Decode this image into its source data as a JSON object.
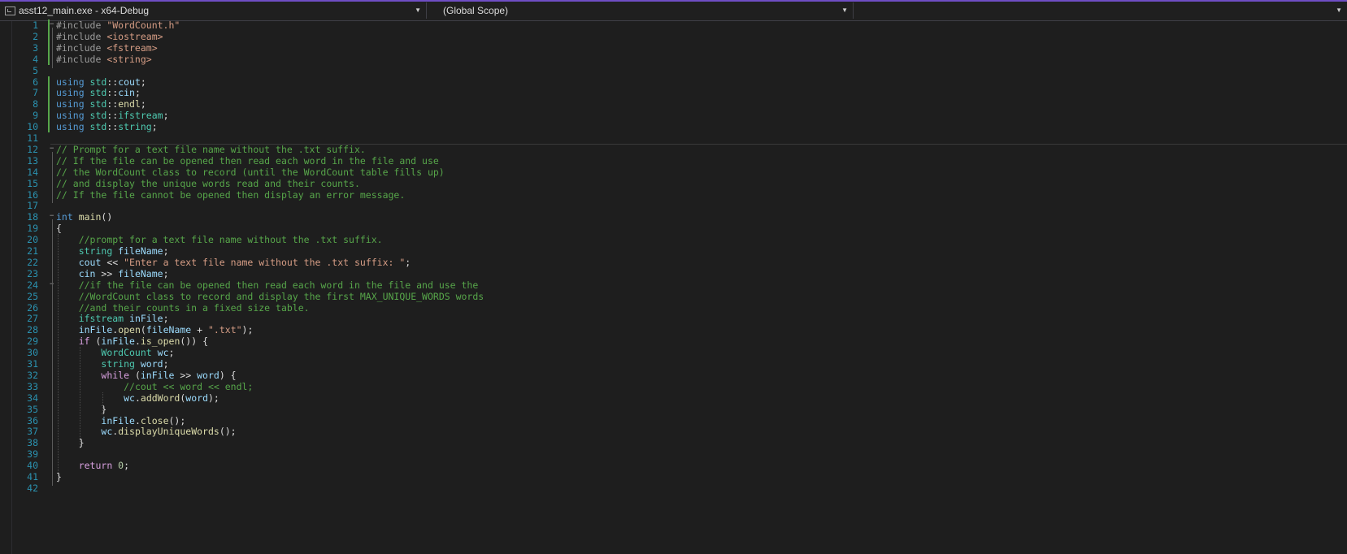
{
  "navbar": {
    "project": "asst12_main.exe - x64-Debug",
    "scope": "(Global Scope)",
    "member": ""
  },
  "editor": {
    "lines": [
      {
        "n": "1",
        "segs": [
          {
            "t": "#include ",
            "c": "pp"
          },
          {
            "t": "\"WordCount.h\"",
            "c": "str"
          }
        ]
      },
      {
        "n": "2",
        "segs": [
          {
            "t": "#include ",
            "c": "pp"
          },
          {
            "t": "<iostream>",
            "c": "str"
          }
        ]
      },
      {
        "n": "3",
        "segs": [
          {
            "t": "#include ",
            "c": "pp"
          },
          {
            "t": "<fstream>",
            "c": "str"
          }
        ]
      },
      {
        "n": "4",
        "segs": [
          {
            "t": "#include ",
            "c": "pp"
          },
          {
            "t": "<string>",
            "c": "str"
          }
        ]
      },
      {
        "n": "5",
        "segs": []
      },
      {
        "n": "6",
        "segs": [
          {
            "t": "using ",
            "c": "kw"
          },
          {
            "t": "std",
            "c": "ty"
          },
          {
            "t": "::",
            "c": ""
          },
          {
            "t": "cout",
            "c": "var"
          },
          {
            "t": ";",
            "c": ""
          }
        ]
      },
      {
        "n": "7",
        "segs": [
          {
            "t": "using ",
            "c": "kw"
          },
          {
            "t": "std",
            "c": "ty"
          },
          {
            "t": "::",
            "c": ""
          },
          {
            "t": "cin",
            "c": "var"
          },
          {
            "t": ";",
            "c": ""
          }
        ]
      },
      {
        "n": "8",
        "segs": [
          {
            "t": "using ",
            "c": "kw"
          },
          {
            "t": "std",
            "c": "ty"
          },
          {
            "t": "::",
            "c": ""
          },
          {
            "t": "endl",
            "c": "fn"
          },
          {
            "t": ";",
            "c": ""
          }
        ]
      },
      {
        "n": "9",
        "segs": [
          {
            "t": "using ",
            "c": "kw"
          },
          {
            "t": "std",
            "c": "ty"
          },
          {
            "t": "::",
            "c": ""
          },
          {
            "t": "ifstream",
            "c": "ty"
          },
          {
            "t": ";",
            "c": ""
          }
        ]
      },
      {
        "n": "10",
        "segs": [
          {
            "t": "using ",
            "c": "kw"
          },
          {
            "t": "std",
            "c": "ty"
          },
          {
            "t": "::",
            "c": ""
          },
          {
            "t": "string",
            "c": "ty"
          },
          {
            "t": ";",
            "c": ""
          }
        ]
      },
      {
        "n": "11",
        "segs": []
      },
      {
        "n": "12",
        "segs": [
          {
            "t": "// Prompt for a text file name without the .txt suffix.",
            "c": "cm"
          }
        ]
      },
      {
        "n": "13",
        "segs": [
          {
            "t": "// If the file can be opened then read each word in the file and use",
            "c": "cm"
          }
        ]
      },
      {
        "n": "14",
        "segs": [
          {
            "t": "// the WordCount class to record (until the WordCount table fills up)",
            "c": "cm"
          }
        ]
      },
      {
        "n": "15",
        "segs": [
          {
            "t": "// and display the unique words read and their counts.",
            "c": "cm"
          }
        ]
      },
      {
        "n": "16",
        "segs": [
          {
            "t": "// If the file cannot be opened then display an error message.",
            "c": "cm"
          }
        ]
      },
      {
        "n": "17",
        "segs": []
      },
      {
        "n": "18",
        "segs": [
          {
            "t": "int ",
            "c": "kw"
          },
          {
            "t": "main",
            "c": "fn"
          },
          {
            "t": "()",
            "c": ""
          }
        ]
      },
      {
        "n": "19",
        "segs": [
          {
            "t": "{",
            "c": ""
          }
        ]
      },
      {
        "n": "20",
        "segs": [
          {
            "t": "    ",
            "c": ""
          },
          {
            "t": "//prompt for a text file name without the .txt suffix.",
            "c": "cm"
          }
        ]
      },
      {
        "n": "21",
        "segs": [
          {
            "t": "    ",
            "c": ""
          },
          {
            "t": "string ",
            "c": "ty"
          },
          {
            "t": "fileName",
            "c": "var"
          },
          {
            "t": ";",
            "c": ""
          }
        ]
      },
      {
        "n": "22",
        "segs": [
          {
            "t": "    ",
            "c": ""
          },
          {
            "t": "cout ",
            "c": "var"
          },
          {
            "t": "<< ",
            "c": ""
          },
          {
            "t": "\"Enter a text file name without the .txt suffix: \"",
            "c": "str"
          },
          {
            "t": ";",
            "c": ""
          }
        ]
      },
      {
        "n": "23",
        "segs": [
          {
            "t": "    ",
            "c": ""
          },
          {
            "t": "cin ",
            "c": "var"
          },
          {
            "t": ">> ",
            "c": ""
          },
          {
            "t": "fileName",
            "c": "var"
          },
          {
            "t": ";",
            "c": ""
          }
        ]
      },
      {
        "n": "24",
        "segs": [
          {
            "t": "    ",
            "c": ""
          },
          {
            "t": "//if the file can be opened then read each word in the file and use the",
            "c": "cm"
          }
        ]
      },
      {
        "n": "25",
        "segs": [
          {
            "t": "    ",
            "c": ""
          },
          {
            "t": "//WordCount class to record and display the first MAX_UNIQUE_WORDS words",
            "c": "cm"
          }
        ]
      },
      {
        "n": "26",
        "segs": [
          {
            "t": "    ",
            "c": ""
          },
          {
            "t": "//and their counts in a fixed size table.",
            "c": "cm"
          }
        ]
      },
      {
        "n": "27",
        "segs": [
          {
            "t": "    ",
            "c": ""
          },
          {
            "t": "ifstream ",
            "c": "ty"
          },
          {
            "t": "inFile",
            "c": "var"
          },
          {
            "t": ";",
            "c": ""
          }
        ]
      },
      {
        "n": "28",
        "segs": [
          {
            "t": "    ",
            "c": ""
          },
          {
            "t": "inFile",
            "c": "var"
          },
          {
            "t": ".",
            "c": ""
          },
          {
            "t": "open",
            "c": "fn"
          },
          {
            "t": "(",
            "c": ""
          },
          {
            "t": "fileName",
            "c": "var"
          },
          {
            "t": " + ",
            "c": ""
          },
          {
            "t": "\".txt\"",
            "c": "str"
          },
          {
            "t": ");",
            "c": ""
          }
        ]
      },
      {
        "n": "29",
        "segs": [
          {
            "t": "    ",
            "c": ""
          },
          {
            "t": "if ",
            "c": "kw2"
          },
          {
            "t": "(",
            "c": ""
          },
          {
            "t": "inFile",
            "c": "var"
          },
          {
            "t": ".",
            "c": ""
          },
          {
            "t": "is_open",
            "c": "fn"
          },
          {
            "t": "()) {",
            "c": ""
          }
        ]
      },
      {
        "n": "30",
        "segs": [
          {
            "t": "        ",
            "c": ""
          },
          {
            "t": "WordCount ",
            "c": "ty"
          },
          {
            "t": "wc",
            "c": "var"
          },
          {
            "t": ";",
            "c": ""
          }
        ]
      },
      {
        "n": "31",
        "segs": [
          {
            "t": "        ",
            "c": ""
          },
          {
            "t": "string ",
            "c": "ty"
          },
          {
            "t": "word",
            "c": "var"
          },
          {
            "t": ";",
            "c": ""
          }
        ]
      },
      {
        "n": "32",
        "segs": [
          {
            "t": "        ",
            "c": ""
          },
          {
            "t": "while ",
            "c": "kw2"
          },
          {
            "t": "(",
            "c": ""
          },
          {
            "t": "inFile",
            "c": "var"
          },
          {
            "t": " >> ",
            "c": ""
          },
          {
            "t": "word",
            "c": "var"
          },
          {
            "t": ") {",
            "c": ""
          }
        ]
      },
      {
        "n": "33",
        "segs": [
          {
            "t": "            ",
            "c": ""
          },
          {
            "t": "//cout << word << endl;",
            "c": "cm"
          }
        ]
      },
      {
        "n": "34",
        "segs": [
          {
            "t": "            ",
            "c": ""
          },
          {
            "t": "wc",
            "c": "var"
          },
          {
            "t": ".",
            "c": ""
          },
          {
            "t": "addWord",
            "c": "fn"
          },
          {
            "t": "(",
            "c": ""
          },
          {
            "t": "word",
            "c": "var"
          },
          {
            "t": ");",
            "c": ""
          }
        ]
      },
      {
        "n": "35",
        "segs": [
          {
            "t": "        }",
            "c": ""
          }
        ]
      },
      {
        "n": "36",
        "segs": [
          {
            "t": "        ",
            "c": ""
          },
          {
            "t": "inFile",
            "c": "var"
          },
          {
            "t": ".",
            "c": ""
          },
          {
            "t": "close",
            "c": "fn"
          },
          {
            "t": "();",
            "c": ""
          }
        ]
      },
      {
        "n": "37",
        "segs": [
          {
            "t": "        ",
            "c": ""
          },
          {
            "t": "wc",
            "c": "var"
          },
          {
            "t": ".",
            "c": ""
          },
          {
            "t": "displayUniqueWords",
            "c": "fn"
          },
          {
            "t": "();",
            "c": ""
          }
        ]
      },
      {
        "n": "38",
        "segs": [
          {
            "t": "    }",
            "c": ""
          }
        ]
      },
      {
        "n": "39",
        "segs": []
      },
      {
        "n": "40",
        "segs": [
          {
            "t": "    ",
            "c": ""
          },
          {
            "t": "return ",
            "c": "kw2"
          },
          {
            "t": "0",
            "c": "num"
          },
          {
            "t": ";",
            "c": ""
          }
        ]
      },
      {
        "n": "41",
        "segs": [
          {
            "t": "}",
            "c": ""
          }
        ]
      },
      {
        "n": "42",
        "segs": []
      }
    ]
  }
}
